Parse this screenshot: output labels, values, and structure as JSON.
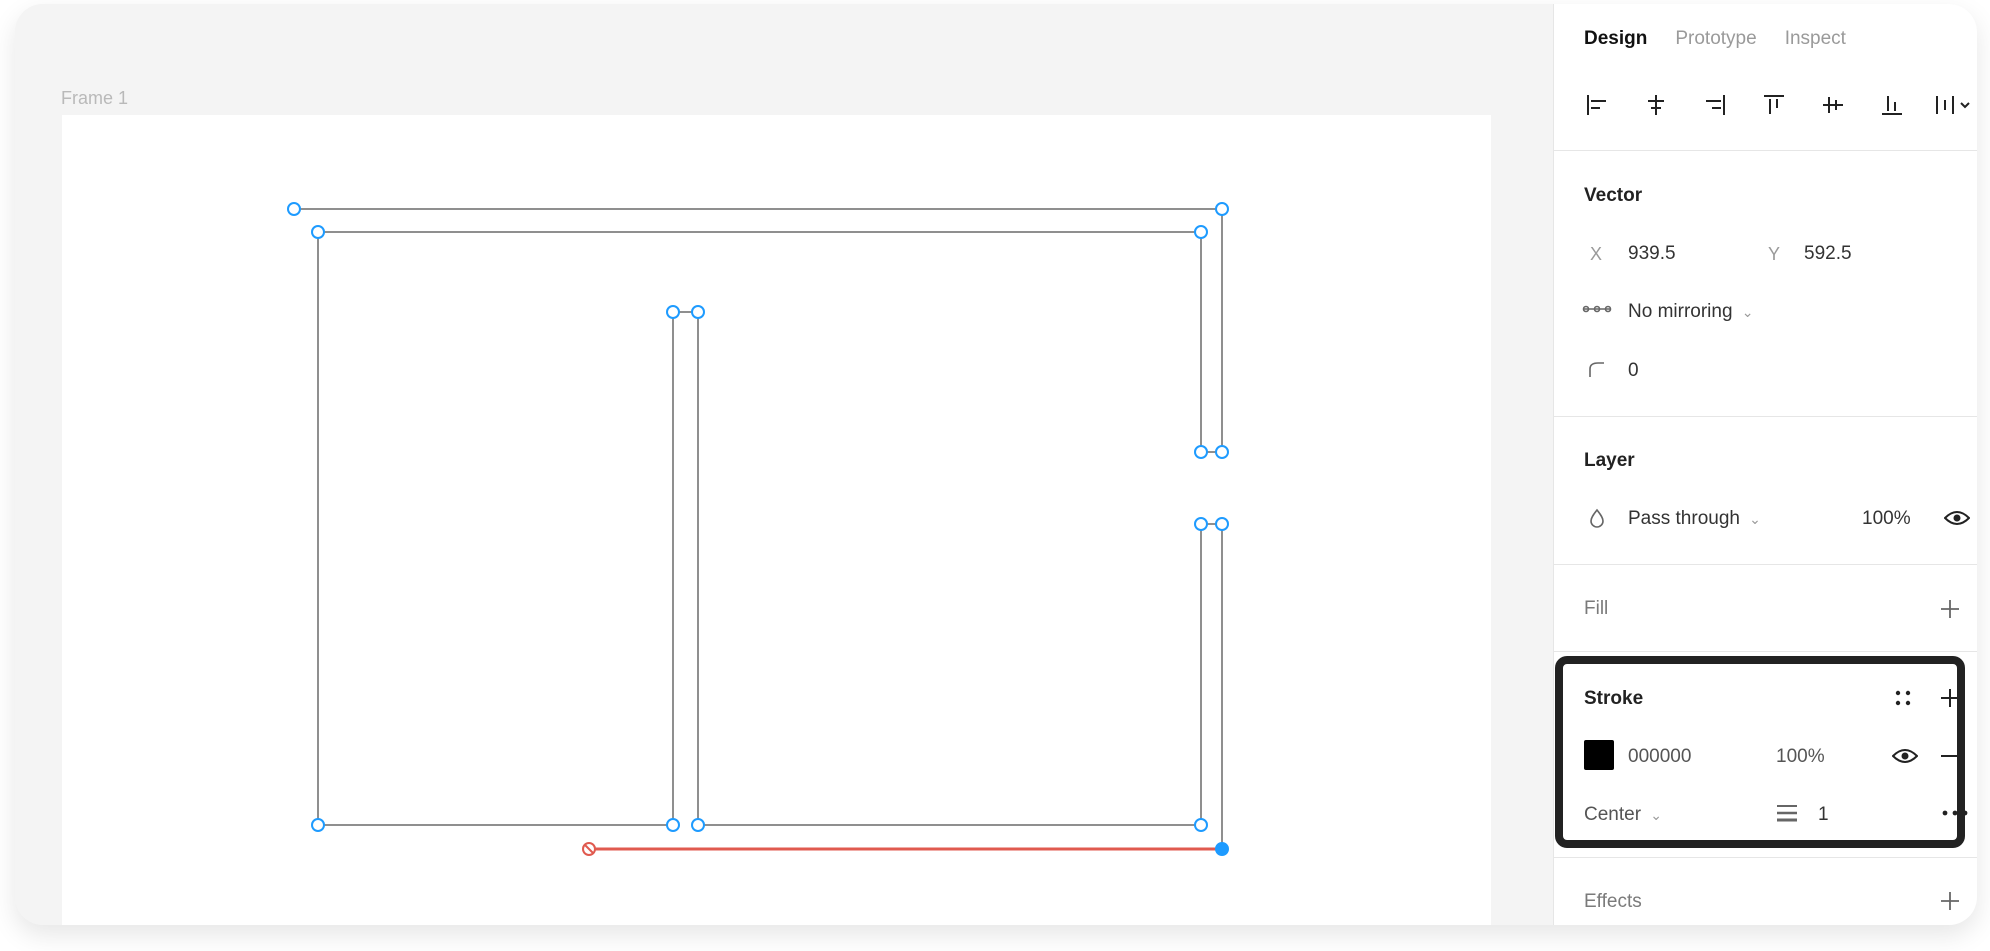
{
  "canvas": {
    "frame_label": "Frame 1"
  },
  "panel": {
    "tabs": [
      {
        "label": "Design",
        "active": true
      },
      {
        "label": "Prototype",
        "active": false
      },
      {
        "label": "Inspect",
        "active": false
      }
    ],
    "vector": {
      "title": "Vector",
      "x_label": "X",
      "x_value": "939.5",
      "y_label": "Y",
      "y_value": "592.5",
      "mirroring": "No mirroring",
      "corner_radius": "0"
    },
    "layer": {
      "title": "Layer",
      "blend_mode": "Pass through",
      "opacity": "100%"
    },
    "fill": {
      "title": "Fill"
    },
    "stroke": {
      "title": "Stroke",
      "color_hex": "000000",
      "swatch_color": "#000000",
      "opacity": "100%",
      "position": "Center",
      "weight": "1"
    },
    "effects": {
      "title": "Effects"
    }
  },
  "colors": {
    "handle": "#1e9bff",
    "selected_segment": "#e05a4f",
    "stroke": "#8f8f8f"
  }
}
